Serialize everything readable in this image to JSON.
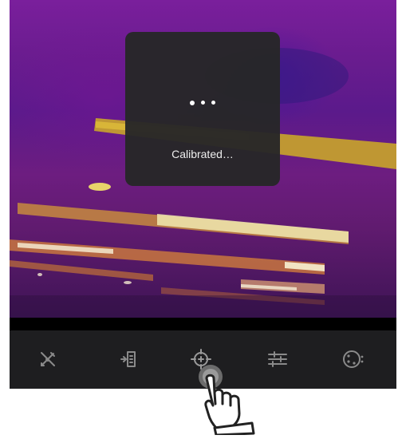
{
  "camera": {
    "view": "thermal-camera-feed"
  },
  "toast": {
    "message": "Calibrated…"
  },
  "toolbar": {
    "tools": [
      {
        "icon": "edit-tools-icon"
      },
      {
        "icon": "import-icon"
      },
      {
        "icon": "calibrate-crosshair-icon"
      },
      {
        "icon": "adjust-sliders-icon"
      },
      {
        "icon": "palette-icon"
      }
    ]
  },
  "overlay": {
    "icon": "pointing-hand-icon"
  },
  "colors": {
    "toolbar_bg": "#1e1e20",
    "toast_bg": "#262628",
    "icon_color": "#8a8a8a"
  }
}
